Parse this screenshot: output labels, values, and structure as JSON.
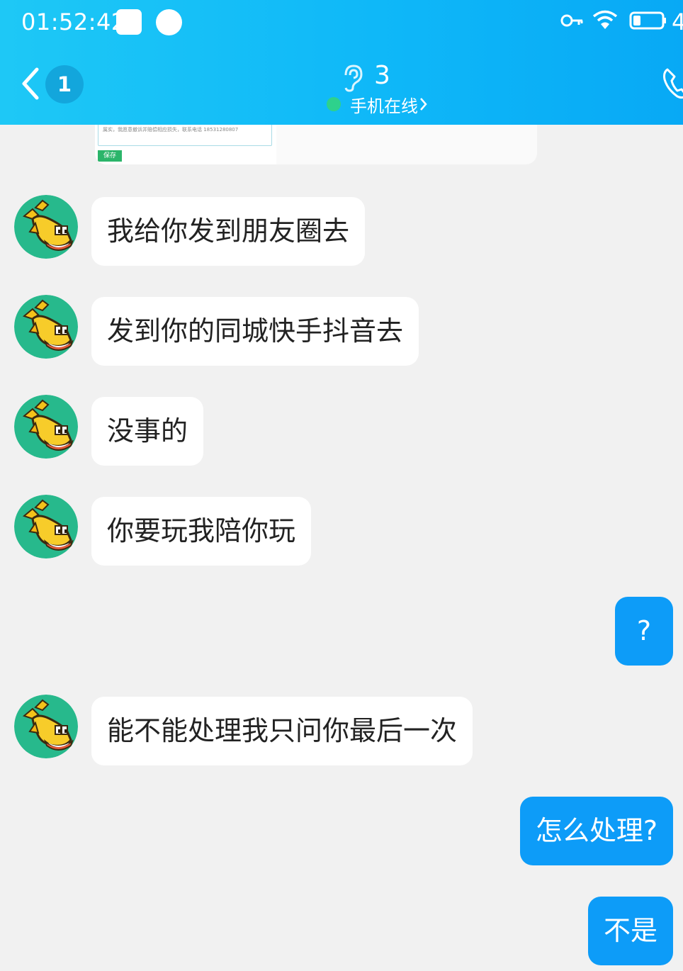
{
  "status_bar": {
    "time": "01:52:42",
    "battery_level_text": "4",
    "icons": [
      "app-notification-icon",
      "app-circle-icon",
      "key-icon",
      "wifi-icon",
      "battery-icon"
    ]
  },
  "header": {
    "unread_count": "1",
    "listener_count": "3",
    "online_status": "手机在线",
    "icons": [
      "back-chevron-icon",
      "ear-icon",
      "chevron-right-icon",
      "phone-icon"
    ]
  },
  "shared_image": {
    "area_text": "属实，我愿意撤诉并赔偿相应损失，联系电话 18531280807",
    "save_label": "保存"
  },
  "messages": [
    {
      "side": "in",
      "text": "我给你发到朋友圈去"
    },
    {
      "side": "in",
      "text": "发到你的同城快手抖音去"
    },
    {
      "side": "in",
      "text": "没事的"
    },
    {
      "side": "in",
      "text": "你要玩我陪你玩"
    },
    {
      "side": "out",
      "text": "?"
    },
    {
      "side": "in",
      "text": "能不能处理我只问你最后一次"
    },
    {
      "side": "out",
      "text": "怎么处理?"
    },
    {
      "side": "out",
      "text": "不是"
    }
  ],
  "colors": {
    "header_bar": "#0fb8f8",
    "chat_background": "#f1f1f1",
    "incoming_bubble": "#ffffff",
    "outgoing_bubble": "#0d9cf8",
    "online_dot": "#2ed18c",
    "avatar_background": "#27b98c"
  }
}
